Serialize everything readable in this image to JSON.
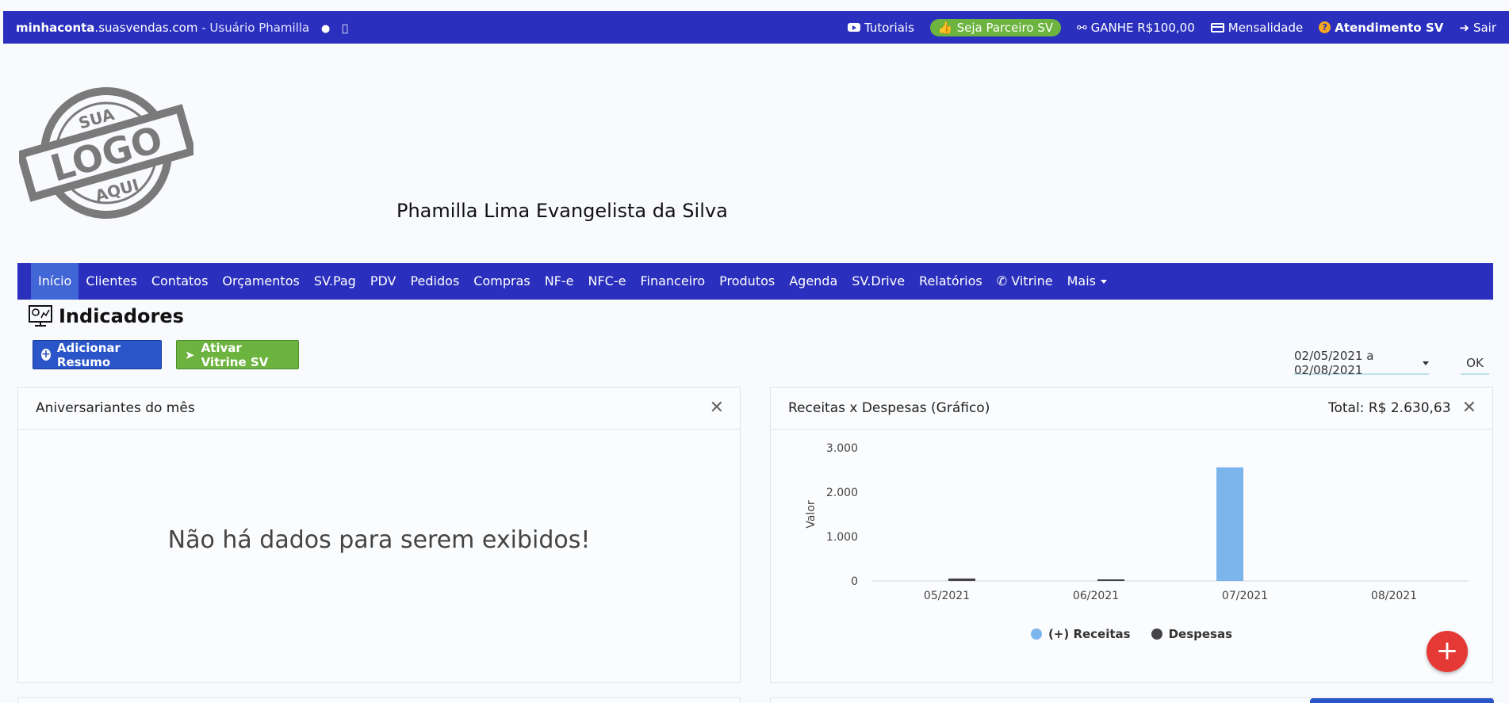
{
  "topbar": {
    "brand_bold": "minhaconta",
    "brand_domain": ".suasvendas.com",
    "user_label": " - Usuário Phamilla",
    "tutoriais": "Tutoriais",
    "parceiro": "Seja Parceiro SV",
    "ganhe": "GANHE R$100,00",
    "mensalidade": "Mensalidade",
    "atendimento": "Atendimento SV",
    "sair": "Sair"
  },
  "logo": {
    "line1": "SUA",
    "line2": "LOGO",
    "line3": "AQUI"
  },
  "owner_name": "Phamilla Lima Evangelista da Silva",
  "nav": [
    {
      "label": "Início"
    },
    {
      "label": "Clientes"
    },
    {
      "label": "Contatos"
    },
    {
      "label": "Orçamentos"
    },
    {
      "label": "SV.Pag"
    },
    {
      "label": "PDV"
    },
    {
      "label": "Pedidos"
    },
    {
      "label": "Compras"
    },
    {
      "label": "NF-e"
    },
    {
      "label": "NFC-e"
    },
    {
      "label": "Financeiro"
    },
    {
      "label": "Produtos"
    },
    {
      "label": "Agenda"
    },
    {
      "label": "SV.Drive"
    },
    {
      "label": "Relatórios"
    },
    {
      "label": "Vitrine"
    },
    {
      "label": "Mais"
    }
  ],
  "indicadores": {
    "title": "Indicadores",
    "add_button": "Adicionar Resumo",
    "vitrine_button": "Ativar Vitrine SV",
    "date_range": "02/05/2021 a 02/08/2021",
    "ok": "OK"
  },
  "panel_left": {
    "title": "Aniversariantes do mês",
    "empty_message": "Não há dados para serem exibidos!"
  },
  "panel_right": {
    "title": "Receitas x Despesas (Gráfico)",
    "total": "Total: R$ 2.630,63"
  },
  "chart_data": {
    "type": "bar",
    "categories": [
      "05/2021",
      "06/2021",
      "07/2021",
      "08/2021"
    ],
    "series": [
      {
        "name": "(+) Receitas",
        "values": [
          0,
          0,
          2560,
          0
        ],
        "color": "#7cb5ec"
      },
      {
        "name": "Despesas",
        "values": [
          55,
          30,
          0,
          0
        ],
        "color": "#434348"
      }
    ],
    "ylabel": "Valor",
    "yticks": [
      "0",
      "1.000",
      "2.000",
      "3.000"
    ],
    "ylim": [
      0,
      3000
    ],
    "legend": "bottom"
  },
  "colors": {
    "primary": "#2a2fbd",
    "active_nav": "#4166d5",
    "success": "#6db33f",
    "danger": "#e53935"
  },
  "fab_label": "+"
}
